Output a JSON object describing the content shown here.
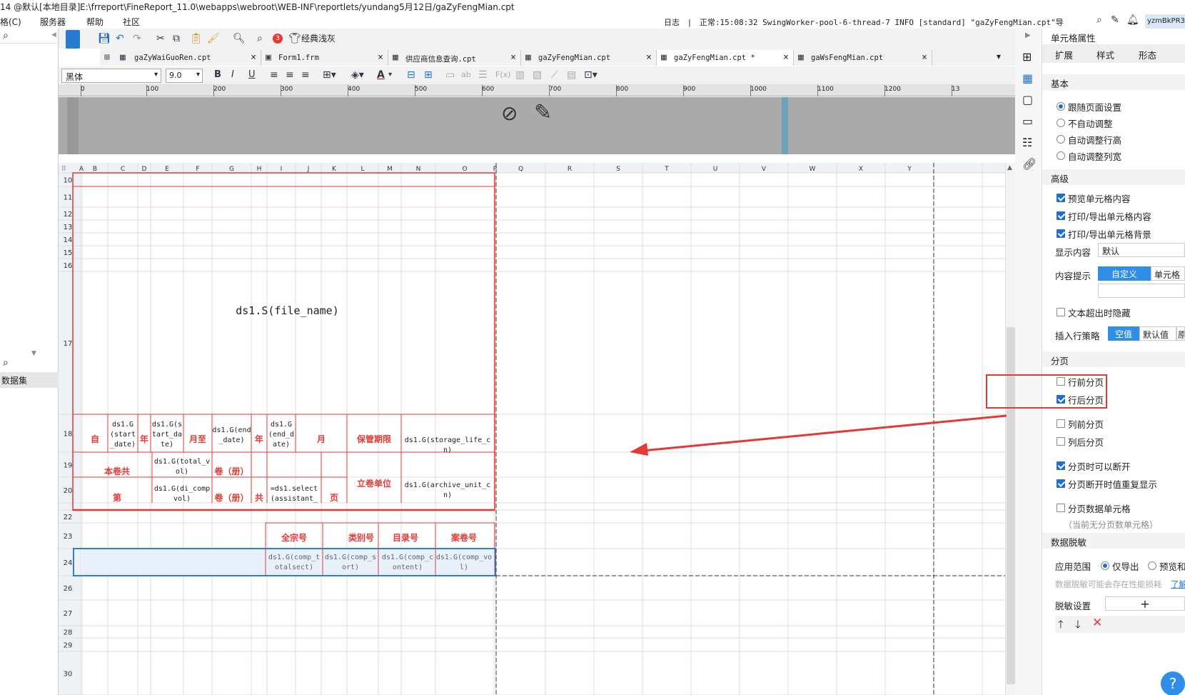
{
  "title": {
    "left": "14 @默认[本地目录]",
    "path": "E:\\frreport\\FineReport_11.0\\webapps\\webroot\\WEB-INF\\reportlets/yundang5月12日/gaZyFengMian.cpt"
  },
  "menu": [
    "格(C)",
    "服务器",
    "帮助",
    "社区"
  ],
  "log": {
    "label": "日志",
    "text": "正常:15:08:32 SwingWorker-pool-6-thread-7 INFO [standard] \"gaZyFengMian.cpt\"导出完毕!"
  },
  "user": "yzmBkPR3",
  "left_panel": {
    "dataset_label": "数据集"
  },
  "toolbar": {
    "badge": "3",
    "theme_label": "经典浅灰"
  },
  "tabs": [
    {
      "label": "gaZyWaiGuoRen.cpt",
      "active": false
    },
    {
      "label": "Form1.frm",
      "active": false
    },
    {
      "label": "供应商信息查询.cpt",
      "active": false
    },
    {
      "label": "gaZyFengMian.cpt",
      "active": false
    },
    {
      "label": "gaZyFengMian.cpt *",
      "active": true
    },
    {
      "label": "gaWsFengMian.cpt",
      "active": false
    }
  ],
  "format": {
    "font": "黑体",
    "size": "9.0",
    "bold": "B",
    "italic": "I",
    "underline": "U",
    "text_color": "A"
  },
  "ruler": [
    "0",
    "100",
    "200",
    "300",
    "400",
    "500",
    "600",
    "700",
    "800",
    "900",
    "1000",
    "1100",
    "1200",
    "13"
  ],
  "columns": [
    "A",
    "B",
    "C",
    "D",
    "E",
    "F",
    "G",
    "H",
    "I",
    "J",
    "K",
    "L",
    "M",
    "N",
    "O",
    "P",
    "Q",
    "R",
    "S",
    "T",
    "U",
    "V",
    "W",
    "X",
    "Y"
  ],
  "rows": [
    "10",
    "11",
    "12",
    "13",
    "14",
    "15",
    "16",
    "17",
    "18",
    "19",
    "20",
    "22",
    "23",
    "24",
    "26",
    "27",
    "28",
    "29",
    "30"
  ],
  "cells": {
    "file_name": "ds1.S(file_name)",
    "zi": "自",
    "start_date_1": "ds1.G(start_date)",
    "nian_1": "年",
    "start_date_2": "ds1.G(start_date)",
    "yuezhi": "月至",
    "end_date_1": "ds1.G(end_date)",
    "nian_2": "年",
    "end_date_2": "ds1.G(end_date)",
    "yue": "月",
    "baoguan": "保管期限",
    "storage_life": "ds1.G(storage_life_cn)",
    "benjuangong": "本卷共",
    "total_vol": "ds1.G(total_vol)",
    "juance_1": "卷（册）",
    "liijuan": "立卷单位",
    "archive_unit": "ds1.G(archive_unit_cn)",
    "di": "第",
    "di_compvol": "ds1.G(di_compvol)",
    "juance_2": "卷（册）",
    "gong": "共",
    "select_assistant": "=ds1.select(assistant_",
    "ye": "页",
    "quanzong": "全宗号",
    "leibie": "类别号",
    "mulu": "目录号",
    "anjuan": "案卷号",
    "comp_totalsect": "ds1.G(comp_totalsect)",
    "comp_sort": "ds1.G(comp_sort)",
    "comp_content": "ds1.G(comp_content)",
    "comp_vol": "ds1.G(comp_vol)"
  },
  "props": {
    "title": "单元格属性",
    "tabs": [
      "扩展",
      "样式",
      "形态"
    ],
    "basic": {
      "title": "基本",
      "options": [
        "跟随页面设置",
        "不自动调整",
        "自动调整行高",
        "自动调整列宽"
      ],
      "selected": 0
    },
    "advanced": {
      "title": "高级",
      "preview": "预览单元格内容",
      "print_content": "打印/导出单元格内容",
      "print_bg": "打印/导出单元格背景",
      "display_label": "显示内容",
      "display_value": "默认",
      "hint_label": "内容提示",
      "hint_btn1": "自定义",
      "hint_btn2": "单元格",
      "overflow_hide": "文本超出时隐藏",
      "insert_label": "插入行策略",
      "insert_btn1": "空值",
      "insert_btn2": "默认值",
      "insert_btn3": "原"
    },
    "paging": {
      "title": "分页",
      "before_row": "行前分页",
      "after_row": "行后分页",
      "before_col": "列前分页",
      "after_col": "列后分页",
      "can_break": "分页时可以断开",
      "repeat": "分页断开时值重复显示",
      "data_cell": "分页数据单元格",
      "note": "（当前无分页数单元格）"
    },
    "desens": {
      "title": "数据脱敏",
      "scope_label": "应用范围",
      "opt1": "仅导出",
      "opt2": "预览和",
      "warn": "数据脱敏可能会存在性能损耗",
      "learn": "了解",
      "setting_label": "脱敏设置",
      "plus": "+"
    }
  },
  "help": "?"
}
